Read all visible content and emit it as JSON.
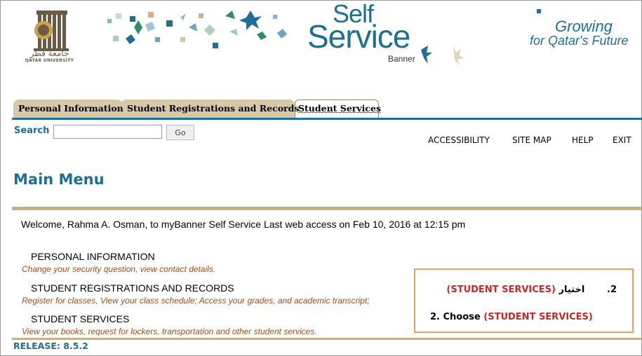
{
  "header": {
    "university_arabic": "جامعة قطر",
    "university_latin": "QATAR UNIVERSITY",
    "self_label": "Self",
    "service_label": "Service",
    "banner_label": "Banner",
    "growing_label": "Growing",
    "future_label": "for Qatar's Future"
  },
  "tabs": [
    {
      "label": "Personal Information",
      "active": false
    },
    {
      "label": "Student Registrations and Records",
      "active": false
    },
    {
      "label": "Student Services",
      "active": true
    }
  ],
  "search": {
    "label": "Search",
    "value": "",
    "button": "Go"
  },
  "top_links": [
    "ACCESSIBILITY",
    "SITE MAP",
    "HELP",
    "EXIT"
  ],
  "page_title": "Main Menu",
  "welcome": "Welcome, Rahma A. Osman, to myBanner Self Service Last web access on Feb 10, 2016 at 12:15 pm",
  "menu": [
    {
      "label": "PERSONAL INFORMATION",
      "description": "Change your security question, view contact details."
    },
    {
      "label": "STUDENT REGISTRATIONS AND RECORDS",
      "description": "Register for classes, View your class schedule; Access your grades, and academic transcript;"
    },
    {
      "label": "STUDENT SERVICES",
      "description": "View your books, request for lockers, transportation and other student services."
    }
  ],
  "release": "RELEASE: 8.5.2",
  "callout": {
    "arabic_number": "2.",
    "arabic_text": "اختيار",
    "arabic_highlight": "(STUDENT SERVICES)",
    "english_text": "2. Choose",
    "english_highlight": "(STUDENT SERVICES)"
  },
  "colors": {
    "brand_blue": "#1f6e93",
    "tab_tan": "#d7c9a8",
    "gold_bar": "#c7b184",
    "desc_text": "#a54d12",
    "callout_border": "#e8a062",
    "highlight_red": "#c62828"
  }
}
